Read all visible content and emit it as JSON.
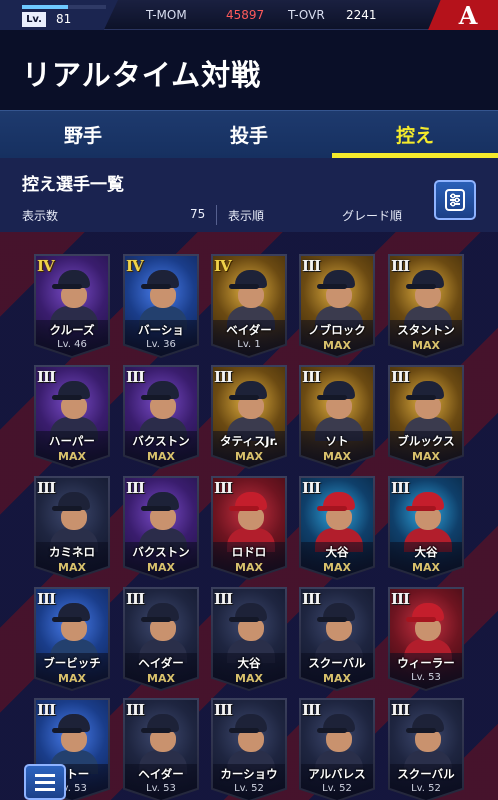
{
  "topbar": {
    "lv_label": "Lv.",
    "lv_value": "81",
    "lv_progress": 0.55,
    "tmom_label": "T-MOM",
    "tmom_value": "45897",
    "tovr_label": "T-OVR",
    "tovr_value": "2241",
    "team_logo": "A"
  },
  "page_title": "リアルタイム対戦",
  "tabs": [
    {
      "label": "野手",
      "active": false
    },
    {
      "label": "投手",
      "active": false
    },
    {
      "label": "控え",
      "active": true
    }
  ],
  "list": {
    "title": "控え選手一覧",
    "count_label": "表示数",
    "count_value": "75",
    "sort_label": "表示順",
    "sort_value": "グレード順",
    "filter_icon": "filter-sliders-icon"
  },
  "cards": [
    {
      "grade": "IV",
      "name": "クルーズ",
      "sub": "Lv. 46",
      "sub_type": "lv",
      "theme": "purple"
    },
    {
      "grade": "IV",
      "name": "バーショ",
      "sub": "Lv. 36",
      "sub_type": "lv",
      "theme": "blue"
    },
    {
      "grade": "IV",
      "name": "ベイダー",
      "sub": "Lv. 1",
      "sub_type": "lv",
      "theme": "gold"
    },
    {
      "grade": "III",
      "name": "ノブロック",
      "sub": "MAX",
      "sub_type": "max",
      "theme": "gold"
    },
    {
      "grade": "III",
      "name": "スタントン",
      "sub": "MAX",
      "sub_type": "max",
      "theme": "gold"
    },
    {
      "grade": "III",
      "name": "ハーパー",
      "sub": "MAX",
      "sub_type": "max",
      "theme": "purple"
    },
    {
      "grade": "III",
      "name": "バクストン",
      "sub": "MAX",
      "sub_type": "max",
      "theme": "purple"
    },
    {
      "grade": "III",
      "name": "タティスJr.",
      "sub": "MAX",
      "sub_type": "max",
      "theme": "gold"
    },
    {
      "grade": "III",
      "name": "ソト",
      "sub": "MAX",
      "sub_type": "max",
      "theme": "gold"
    },
    {
      "grade": "III",
      "name": "ブルックス",
      "sub": "MAX",
      "sub_type": "max",
      "theme": "gold"
    },
    {
      "grade": "III",
      "name": "カミネロ",
      "sub": "MAX",
      "sub_type": "max",
      "theme": "dark"
    },
    {
      "grade": "III",
      "name": "バクストン",
      "sub": "MAX",
      "sub_type": "max",
      "theme": "purple"
    },
    {
      "grade": "III",
      "name": "ロドロ",
      "sub": "MAX",
      "sub_type": "max",
      "theme": "red"
    },
    {
      "grade": "III",
      "name": "大谷",
      "sub": "MAX",
      "sub_type": "max",
      "theme": "cyan"
    },
    {
      "grade": "III",
      "name": "大谷",
      "sub": "MAX",
      "sub_type": "max",
      "theme": "cyan"
    },
    {
      "grade": "III",
      "name": "ブービッチ",
      "sub": "MAX",
      "sub_type": "max",
      "theme": "blue"
    },
    {
      "grade": "III",
      "name": "ヘイダー",
      "sub": "MAX",
      "sub_type": "max",
      "theme": "dark"
    },
    {
      "grade": "III",
      "name": "大谷",
      "sub": "MAX",
      "sub_type": "max",
      "theme": "dark"
    },
    {
      "grade": "III",
      "name": "スクーバル",
      "sub": "MAX",
      "sub_type": "max",
      "theme": "dark"
    },
    {
      "grade": "III",
      "name": "ウィーラー",
      "sub": "Lv. 53",
      "sub_type": "lv",
      "theme": "red"
    },
    {
      "grade": "III",
      "name": "ヘトー",
      "sub": "Lv. 53",
      "sub_type": "lv",
      "theme": "blue"
    },
    {
      "grade": "III",
      "name": "ヘイダー",
      "sub": "Lv. 53",
      "sub_type": "lv",
      "theme": "dark"
    },
    {
      "grade": "III",
      "name": "カーショウ",
      "sub": "Lv. 52",
      "sub_type": "lv",
      "theme": "dark"
    },
    {
      "grade": "III",
      "name": "アルバレス",
      "sub": "Lv. 52",
      "sub_type": "lv",
      "theme": "dark"
    },
    {
      "grade": "III",
      "name": "スクーバル",
      "sub": "Lv. 52",
      "sub_type": "lv",
      "theme": "dark"
    }
  ],
  "menu_icon": "hamburger-menu-icon"
}
